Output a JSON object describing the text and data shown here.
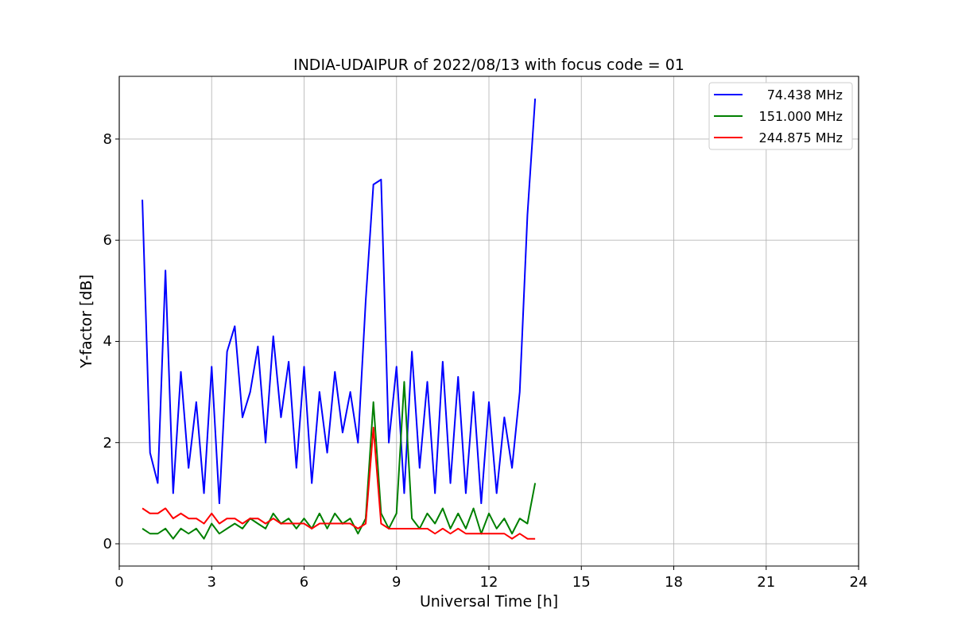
{
  "chart_data": {
    "type": "line",
    "title": "INDIA-UDAIPUR of 2022/08/13 with focus code = 01",
    "xlabel": "Universal Time [h]",
    "ylabel": "Y-factor [dB]",
    "x": [
      0.75,
      1.0,
      1.25,
      1.5,
      1.75,
      2.0,
      2.25,
      2.5,
      2.75,
      3.0,
      3.25,
      3.5,
      3.75,
      4.0,
      4.25,
      4.5,
      4.75,
      5.0,
      5.25,
      5.5,
      5.75,
      6.0,
      6.25,
      6.5,
      6.75,
      7.0,
      7.25,
      7.5,
      7.75,
      8.0,
      8.25,
      8.5,
      8.75,
      9.0,
      9.25,
      9.5,
      9.75,
      10.0,
      10.25,
      10.5,
      10.75,
      11.0,
      11.25,
      11.5,
      11.75,
      12.0,
      12.25,
      12.5,
      12.75,
      13.0,
      13.25,
      13.5
    ],
    "series": [
      {
        "name": "74.438 MHz",
        "color": "#0000ff",
        "values": [
          6.8,
          1.8,
          1.2,
          5.4,
          1.0,
          3.4,
          1.5,
          2.8,
          1.0,
          3.5,
          0.8,
          3.8,
          4.3,
          2.5,
          3.0,
          3.9,
          2.0,
          4.1,
          2.5,
          3.6,
          1.5,
          3.5,
          1.2,
          3.0,
          1.8,
          3.4,
          2.2,
          3.0,
          2.0,
          4.8,
          7.1,
          7.2,
          2.0,
          3.5,
          1.0,
          3.8,
          1.5,
          3.2,
          1.0,
          3.6,
          1.2,
          3.3,
          1.0,
          3.0,
          0.8,
          2.8,
          1.0,
          2.5,
          1.5,
          3.0,
          6.5,
          8.8
        ]
      },
      {
        "name": "151.000 MHz",
        "color": "#008000",
        "values": [
          0.3,
          0.2,
          0.2,
          0.3,
          0.1,
          0.3,
          0.2,
          0.3,
          0.1,
          0.4,
          0.2,
          0.3,
          0.4,
          0.3,
          0.5,
          0.4,
          0.3,
          0.6,
          0.4,
          0.5,
          0.3,
          0.5,
          0.3,
          0.6,
          0.3,
          0.6,
          0.4,
          0.5,
          0.2,
          0.5,
          2.8,
          0.6,
          0.3,
          0.6,
          3.2,
          0.5,
          0.3,
          0.6,
          0.4,
          0.7,
          0.3,
          0.6,
          0.3,
          0.7,
          0.2,
          0.6,
          0.3,
          0.5,
          0.2,
          0.5,
          0.4,
          1.2
        ]
      },
      {
        "name": "244.875 MHz",
        "color": "#ff0000",
        "values": [
          0.7,
          0.6,
          0.6,
          0.7,
          0.5,
          0.6,
          0.5,
          0.5,
          0.4,
          0.6,
          0.4,
          0.5,
          0.5,
          0.4,
          0.5,
          0.5,
          0.4,
          0.5,
          0.4,
          0.4,
          0.4,
          0.4,
          0.3,
          0.4,
          0.4,
          0.4,
          0.4,
          0.4,
          0.3,
          0.4,
          2.3,
          0.4,
          0.3,
          0.3,
          0.3,
          0.3,
          0.3,
          0.3,
          0.2,
          0.3,
          0.2,
          0.3,
          0.2,
          0.2,
          0.2,
          0.2,
          0.2,
          0.2,
          0.1,
          0.2,
          0.1,
          0.1
        ]
      }
    ],
    "grid": true,
    "legend": true,
    "xlim": [
      0,
      24
    ],
    "ylim": [
      -0.44,
      9.24
    ],
    "xticks": [
      0,
      3,
      6,
      9,
      12,
      15,
      18,
      21,
      24
    ],
    "yticks": [
      0,
      2,
      4,
      6,
      8
    ]
  }
}
